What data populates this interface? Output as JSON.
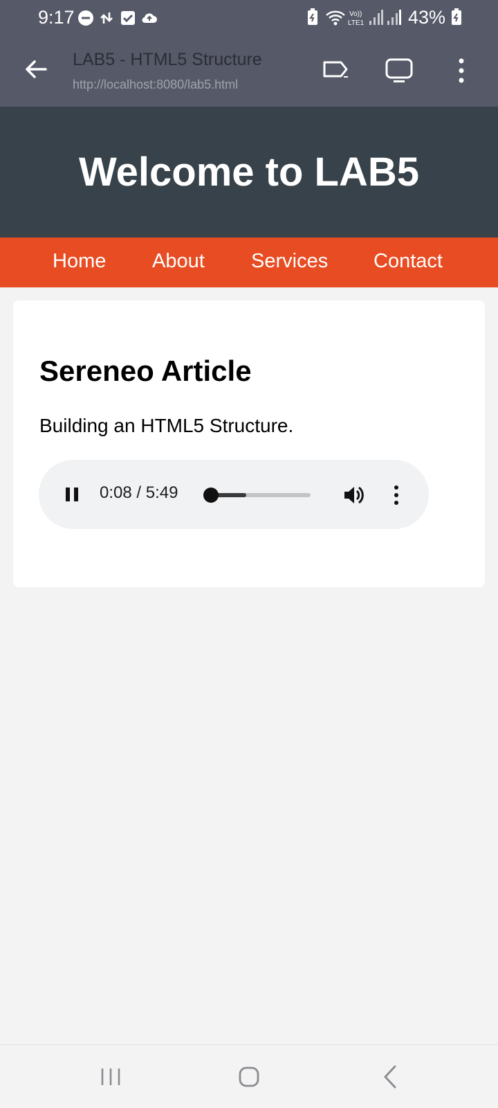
{
  "status": {
    "time": "9:17",
    "battery": "43%",
    "icons": [
      "do-not-disturb-icon",
      "data-transfer-icon",
      "checkbox-icon",
      "cloud-upload-icon",
      "battery-saver-icon",
      "wifi-icon",
      "volte-icon",
      "signal-icon",
      "signal-icon",
      "battery-icon"
    ]
  },
  "app_bar": {
    "title": "LAB5 - HTML5 Structure",
    "url": "http://localhost:8080/lab5.html"
  },
  "page": {
    "heading": "Welcome to LAB5",
    "nav": [
      "Home",
      "About",
      "Services",
      "Contact"
    ],
    "article": {
      "title": "Sereneo Article",
      "text": "Building an HTML5 Structure."
    },
    "audio": {
      "time_display": "0:08 / 5:49",
      "progress_fraction": 0.024,
      "buffered_fraction": 0.37
    }
  },
  "colors": {
    "header_bg": "#37424a",
    "nav_bg": "#e84c22",
    "app_bar_bg": "#565968"
  }
}
